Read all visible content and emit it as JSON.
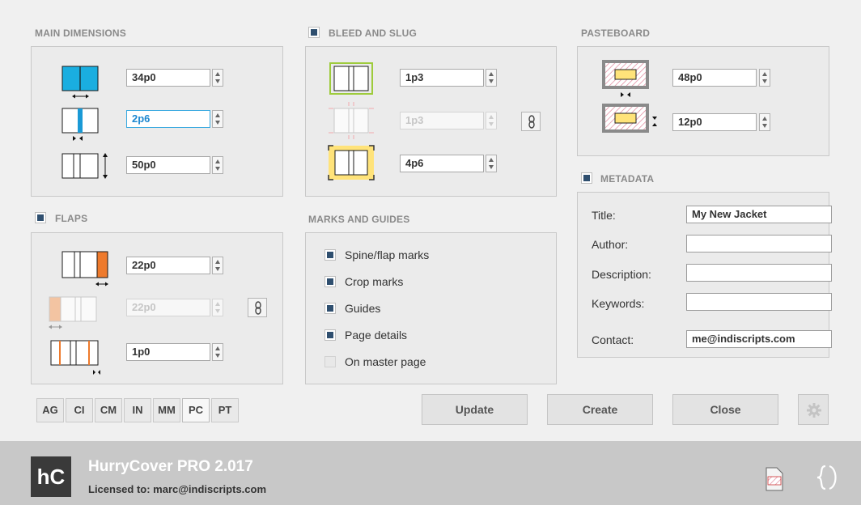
{
  "main_dimensions": {
    "title": "MAIN DIMENSIONS",
    "width_value": "34p0",
    "spine_value": "2p6",
    "height_value": "50p0"
  },
  "bleed_slug": {
    "title": "BLEED AND SLUG",
    "checked": true,
    "bleed_value": "1p3",
    "bleed_secondary_value": "1p3",
    "slug_value": "4p6"
  },
  "pasteboard": {
    "title": "PASTEBOARD",
    "width_value": "48p0",
    "height_value": "12p0"
  },
  "flaps": {
    "title": "FLAPS",
    "checked": true,
    "right_flap_value": "22p0",
    "left_flap_value": "22p0",
    "fold_value": "1p0"
  },
  "marks_guides": {
    "title": "MARKS AND GUIDES",
    "options": [
      {
        "label": "Spine/flap marks",
        "checked": true
      },
      {
        "label": "Crop marks",
        "checked": true
      },
      {
        "label": "Guides",
        "checked": true
      },
      {
        "label": "Page details",
        "checked": true
      },
      {
        "label": "On master page",
        "checked": false
      }
    ]
  },
  "metadata": {
    "title": "METADATA",
    "checked": true,
    "title_label": "Title:",
    "title_value": "My New Jacket",
    "author_label": "Author:",
    "author_value": "",
    "description_label": "Description:",
    "description_value": "",
    "keywords_label": "Keywords:",
    "keywords_value": "",
    "contact_label": "Contact:",
    "contact_value": "me@indiscripts.com"
  },
  "units": [
    "AG",
    "CI",
    "CM",
    "IN",
    "MM",
    "PC",
    "PT"
  ],
  "selected_unit": "PC",
  "buttons": {
    "update": "Update",
    "create": "Create",
    "close": "Close"
  },
  "footer": {
    "logo_text": "hC",
    "product_name": "HurryCover PRO 2.017",
    "license_text": "Licensed to: marc@indiscripts.com"
  },
  "colors": {
    "accent_blue": "#1aaee0",
    "spine_blue": "#1a9ad6",
    "flap_orange": "#ee7a2c",
    "bleed_green": "#9ecb3c",
    "slug_yellow": "#ffe37a",
    "checkbox_fill": "#2f4f6f",
    "focus_border": "#39a9e0"
  }
}
